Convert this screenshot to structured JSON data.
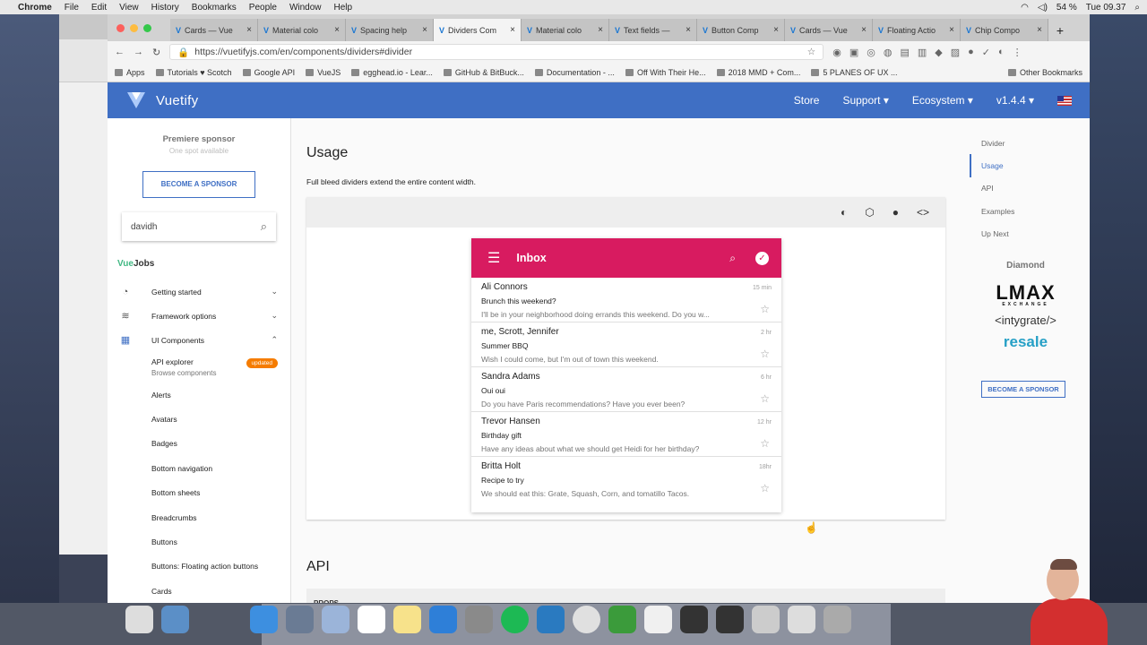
{
  "os": {
    "app": "Chrome",
    "menus": [
      "File",
      "Edit",
      "View",
      "History",
      "Bookmarks",
      "People",
      "Window",
      "Help"
    ],
    "battery": "54 %",
    "clock": "Tue 09.37"
  },
  "tabs": [
    {
      "label": "Cards — Vue",
      "active": false
    },
    {
      "label": "Material colo",
      "active": false
    },
    {
      "label": "Spacing help",
      "active": false
    },
    {
      "label": "Dividers Com",
      "active": true
    },
    {
      "label": "Material colo",
      "active": false
    },
    {
      "label": "Text fields —",
      "active": false
    },
    {
      "label": "Button Comp",
      "active": false
    },
    {
      "label": "Cards — Vue",
      "active": false
    },
    {
      "label": "Floating Actio",
      "active": false
    },
    {
      "label": "Chip Compo",
      "active": false
    }
  ],
  "url": "https://vuetifyjs.com/en/components/dividers#divider",
  "bookmarks": [
    "Apps",
    "Tutorials ♥ Scotch",
    "Google API",
    "VueJS",
    "egghead.io - Lear...",
    "GitHub & BitBuck...",
    "Documentation - ...",
    "Off With Their He...",
    "2018 MMD + Com...",
    "5 PLANES OF UX ..."
  ],
  "other_bookmarks": "Other Bookmarks",
  "header": {
    "brand": "Vuetify",
    "nav": [
      "Store",
      "Support",
      "Ecosystem",
      "v1.4.4"
    ]
  },
  "sidebar": {
    "sponsor_title": "Premiere sponsor",
    "sponsor_sub": "One spot available",
    "sponsor_button": "BECOME A SPONSOR",
    "search_value": "davidh",
    "vuejobs_a": "Vue",
    "vuejobs_b": "Jobs",
    "groups": [
      {
        "label": "Getting started",
        "icon": "speed-icon",
        "chev": "⌄"
      },
      {
        "label": "Framework options",
        "icon": "layers-icon",
        "chev": "⌄"
      },
      {
        "label": "UI Components",
        "icon": "grid-icon",
        "chev": "⌃"
      }
    ],
    "api_explorer": "API explorer",
    "browse": "Browse components",
    "badge": "updated",
    "items": [
      "Alerts",
      "Avatars",
      "Badges",
      "Bottom navigation",
      "Bottom sheets",
      "Breadcrumbs",
      "Buttons",
      "Buttons: Floating action buttons",
      "Cards"
    ]
  },
  "main": {
    "heading": "Usage",
    "desc": "Full bleed dividers extend the entire content width.",
    "inbox_title": "Inbox",
    "mails": [
      {
        "name": "Ali Connors",
        "subject": "Brunch this weekend?",
        "preview": "I'll be in your neighborhood doing errands this weekend. Do you w...",
        "time": "15 min"
      },
      {
        "name": "me, Scrott, Jennifer",
        "subject": "Summer BBQ",
        "preview": "Wish I could come, but I'm out of town this weekend.",
        "time": "2 hr"
      },
      {
        "name": "Sandra Adams",
        "subject": "Oui oui",
        "preview": "Do you have Paris recommendations? Have you ever been?",
        "time": "6 hr"
      },
      {
        "name": "Trevor Hansen",
        "subject": "Birthday gift",
        "preview": "Have any ideas about what we should get Heidi for her birthday?",
        "time": "12 hr"
      },
      {
        "name": "Britta Holt",
        "subject": "Recipe to try",
        "preview": "We should eat this: Grate, Squash, Corn, and tomatillo Tacos.",
        "time": "18hr"
      }
    ],
    "api_heading": "API",
    "props_label": "PROPS"
  },
  "toc": {
    "items": [
      "Divider",
      "Usage",
      "API",
      "Examples",
      "Up Next"
    ],
    "active": 1,
    "diamond": "Diamond",
    "lmax": "LMAX",
    "lmax_sub": "EXCHANGE",
    "intygrate": "<intygrate/>",
    "resale": "resale",
    "sponsor_button": "BECOME A SPONSOR"
  },
  "colors": {
    "primary": "#3f6fc4",
    "inbox": "#d81b60"
  }
}
